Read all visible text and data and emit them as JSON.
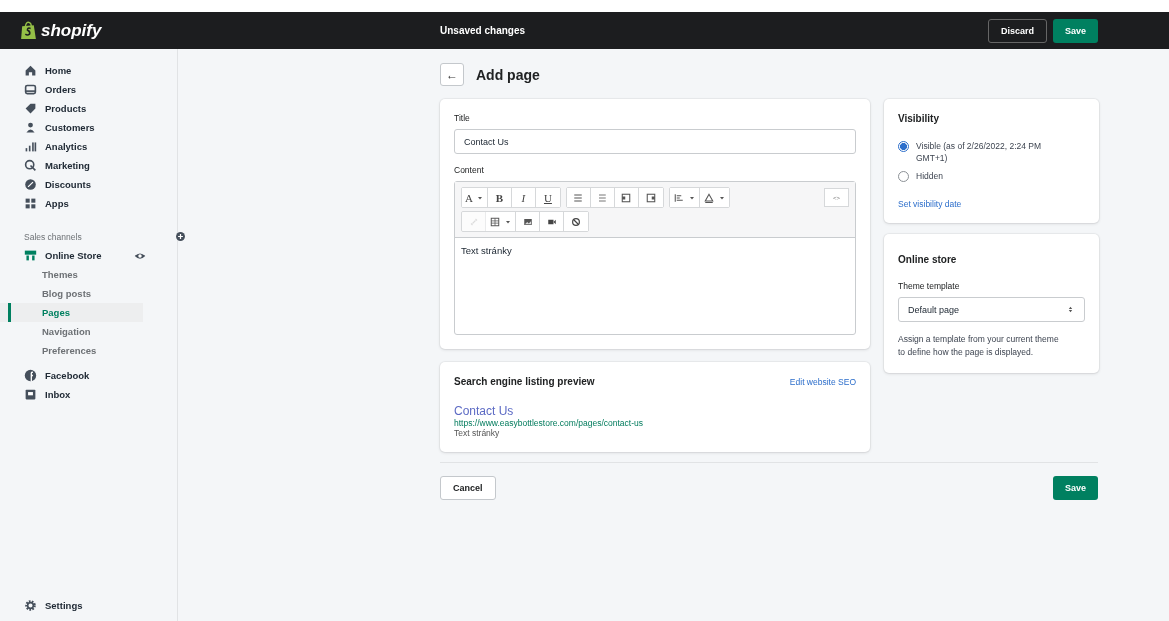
{
  "topbar": {
    "logo": "shopify",
    "status": "Unsaved changes",
    "buttons": [
      {
        "label": "Discard",
        "kind": "secondary"
      },
      {
        "label": "Save",
        "kind": "primary"
      }
    ]
  },
  "sidebar": {
    "items": [
      {
        "label": "Home",
        "selected": false
      },
      {
        "label": "Orders",
        "selected": false
      },
      {
        "label": "Products",
        "selected": false
      },
      {
        "label": "Customers",
        "selected": false
      },
      {
        "label": "Analytics",
        "selected": false
      },
      {
        "label": "Marketing",
        "selected": false
      },
      {
        "label": "Discounts",
        "selected": false
      },
      {
        "label": "Apps",
        "selected": false
      }
    ],
    "section": {
      "label": "Sales channels"
    },
    "channels": [
      {
        "label": "Online Store",
        "selected": false,
        "children": [
          {
            "label": "Themes",
            "selected": false
          },
          {
            "label": "Blog posts",
            "selected": false
          },
          {
            "label": "Pages",
            "selected": true
          },
          {
            "label": "Navigation",
            "selected": false
          },
          {
            "label": "Preferences",
            "selected": false
          }
        ]
      },
      {
        "label": "Facebook",
        "selected": false
      },
      {
        "label": "Inbox",
        "selected": false
      }
    ],
    "settings": {
      "label": "Settings"
    }
  },
  "header": {
    "back": "←",
    "title": "Add page"
  },
  "page_card": {
    "title_label": "Title",
    "title_value": "Contact Us",
    "content_label": "Content",
    "format_buttons": [
      "A",
      "B",
      "I",
      "U"
    ],
    "source_button": "<>",
    "toolbar_row2": [
      {
        "disabled": true
      },
      {
        "disabled": false
      },
      {
        "disabled": false
      },
      {
        "disabled": false
      },
      {
        "disabled": false
      }
    ],
    "content_value": "Text stránky"
  },
  "seo_card": {
    "title": "Search engine listing preview",
    "link": "Edit website SEO",
    "preview_title": "Contact Us",
    "preview_url": "https://www.easybottlestore.com/pages/contact-us",
    "preview_description": "Text stránky"
  },
  "visibility_card": {
    "title": "Visibility",
    "options": [
      {
        "label": "Visible (as of 2/26/2022, 2:24 PM GMT+1)",
        "selected": true
      },
      {
        "label": "Hidden",
        "selected": false
      }
    ],
    "link": "Set visibility date"
  },
  "online_store_card": {
    "title": "Online store",
    "select_label": "Theme template",
    "select_value": "Default page",
    "help": "Assign a template from your current theme to define how the page is displayed."
  },
  "footer": {
    "cancel": "Cancel",
    "save": "Save"
  }
}
